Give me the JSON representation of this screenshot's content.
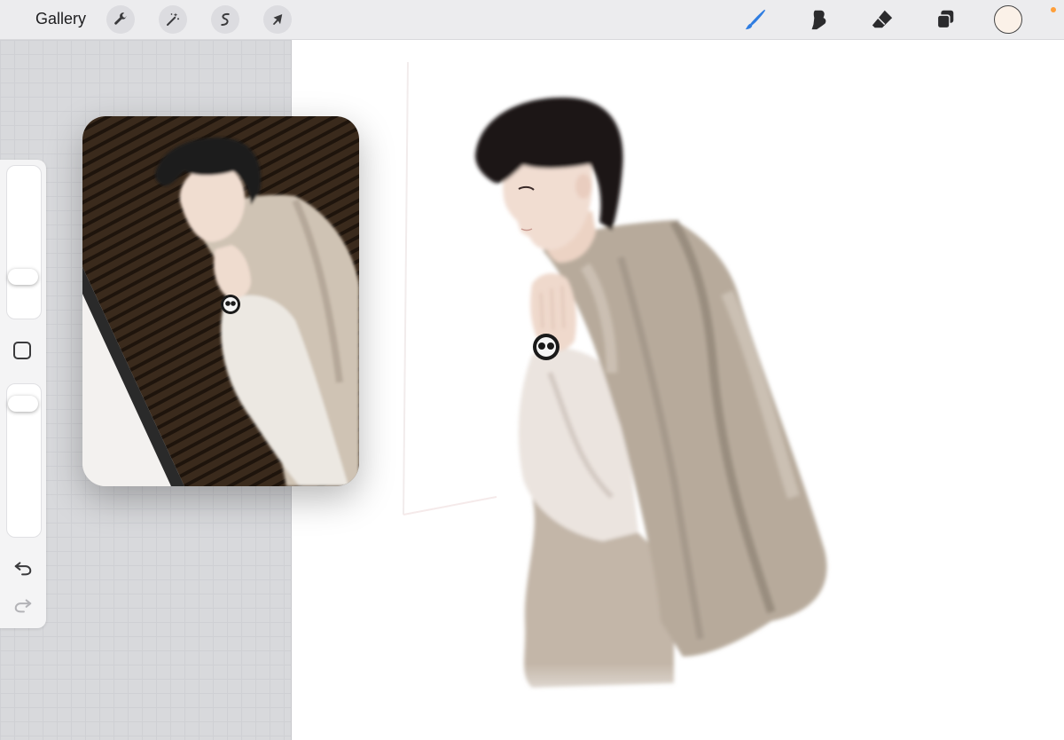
{
  "topbar": {
    "gallery_label": "Gallery",
    "left_tools": [
      {
        "name": "actions",
        "icon": "wrench-icon"
      },
      {
        "name": "adjustments",
        "icon": "magic-wand-icon"
      },
      {
        "name": "selection",
        "icon": "selection-s-icon"
      },
      {
        "name": "transform",
        "icon": "arrow-cursor-icon"
      }
    ],
    "right_tools": [
      {
        "name": "brush",
        "icon": "brush-icon",
        "active": true
      },
      {
        "name": "smudge",
        "icon": "smudge-finger-icon",
        "active": false
      },
      {
        "name": "eraser",
        "icon": "eraser-icon",
        "active": false
      },
      {
        "name": "layers",
        "icon": "layers-icon",
        "active": false
      }
    ],
    "current_color": "#fbf1e8",
    "status_dot_color": "#ff9f3a",
    "active_color": "#2f7de1"
  },
  "sidebar": {
    "brush_size_level": 0.24,
    "opacity_level": 0.93,
    "modify_icon": "square-modify-icon",
    "undo_icon": "undo-arrow-icon",
    "redo_icon": "redo-arrow-icon"
  },
  "reference": {
    "icon": "reference-photo",
    "description_colors": {
      "coat": "#cfc3b4",
      "hair": "#1c1a1a",
      "shirt": "#ece8e2",
      "door": "#3a2a1c"
    }
  },
  "canvas": {
    "artwork_icon": "painted-figure-illustration",
    "colors": {
      "coat": "#b7aa9b",
      "coat_shadow": "#8f8376",
      "hair": "#1e1818",
      "skin": "#efd9cc",
      "shirt": "#ece4de"
    }
  }
}
